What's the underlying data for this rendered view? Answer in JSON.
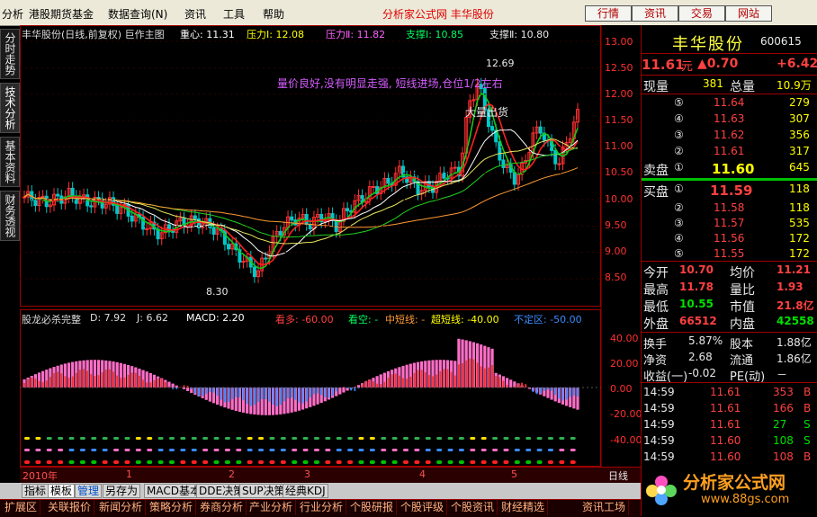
{
  "menu": [
    "分析",
    "港股期货基金",
    "数据查询(N)",
    "资讯",
    "工具",
    "帮助"
  ],
  "top_link": "分析家公式网 丰华股份",
  "top_buttons": [
    "行情",
    "资讯",
    "交易",
    "网站"
  ],
  "left_tabs": [
    "分时走势",
    "技术分析",
    "基本资料",
    "财务透视"
  ],
  "main_header": {
    "title": "丰华股份(日线,前复权) 巨作主图",
    "zhongxin": "重心: 11.31",
    "yali1": "压力Ⅰ: 12.08",
    "yali2": "压力Ⅱ: 11.82",
    "zhicheng1": "支撑Ⅰ: 10.85",
    "zhicheng2": "支撑Ⅱ: 10.80"
  },
  "annotations": {
    "comment": "量价良好,没有明显走强, 短线进场,仓位1/2左右",
    "ship": "大量出货",
    "high_label": "12.69",
    "low_label": "8.30"
  },
  "price_axis": [
    "13.00",
    "12.50",
    "12.00",
    "11.50",
    "11.00",
    "10.50",
    "10.00",
    "9.50",
    "9.00",
    "8.50"
  ],
  "indicator_header": {
    "title": "股龙必杀完整",
    "d": "D: 7.92",
    "j": "J: 6.62",
    "macd": "MACD: 2.20",
    "kanduo": "看多: -60.00",
    "kankong": "看空: -",
    "zhongduan": "中短线: -",
    "chaoduan": "超短线: -40.00",
    "buding": "不定区: -50.00"
  },
  "indicator_axis": [
    "40.00",
    "20.00",
    "0.00",
    "-20.00",
    "-40.00"
  ],
  "time_axis": {
    "year": "2010年",
    "months": [
      "1",
      "2",
      "3",
      "4",
      "5"
    ],
    "period": "日线"
  },
  "bottom_tabs": [
    "指标",
    "模板",
    "管理",
    "另存为",
    "MACD基本",
    "DDE决策",
    "SUP决策",
    "经典KDJ"
  ],
  "bottom_nav": [
    "扩展区",
    "关联报价",
    "新闻分析",
    "策略分析",
    "券商分析",
    "产业分析",
    "行业分析",
    "个股研报",
    "个股评级",
    "个股资讯",
    "财经精选",
    "资讯工场"
  ],
  "quote": {
    "name": "丰华股份",
    "code": "600615",
    "price": "11.61",
    "price_unit": "元",
    "change": "▲0.70",
    "pct": "+6.42",
    "xianliang_label": "现量",
    "xianliang": "381",
    "zongliang_label": "总量",
    "zongliang": "10.9万",
    "sell": [
      {
        "lv": "⑤",
        "price": "11.64",
        "vol": "279"
      },
      {
        "lv": "④",
        "price": "11.63",
        "vol": "307"
      },
      {
        "lv": "③",
        "price": "11.62",
        "vol": "356"
      },
      {
        "lv": "②",
        "price": "11.61",
        "vol": "317"
      }
    ],
    "sell1": {
      "label": "卖盘",
      "lv": "①",
      "price": "11.60",
      "vol": "645"
    },
    "buy1": {
      "label": "买盘",
      "lv": "①",
      "price": "11.59",
      "vol": "118"
    },
    "buy": [
      {
        "lv": "②",
        "price": "11.58",
        "vol": "118"
      },
      {
        "lv": "③",
        "price": "11.57",
        "vol": "535"
      },
      {
        "lv": "④",
        "price": "11.56",
        "vol": "172"
      },
      {
        "lv": "⑤",
        "price": "11.55",
        "vol": "172"
      }
    ],
    "stats": [
      {
        "l1": "今开",
        "v1": "10.70",
        "l2": "均价",
        "v2": "11.21"
      },
      {
        "l1": "最高",
        "v1": "11.78",
        "l2": "量比",
        "v2": "1.93"
      },
      {
        "l1": "最低",
        "v1": "10.55",
        "l2": "市值",
        "v2": "21.8亿"
      },
      {
        "l1": "外盘",
        "v1": "66512",
        "l2": "内盘",
        "v2": "42558"
      }
    ],
    "stats2": [
      {
        "l1": "换手",
        "v1": "5.87%",
        "l2": "股本",
        "v2": "1.88亿"
      },
      {
        "l1": "净资",
        "v1": "2.68",
        "l2": "流通",
        "v2": "1.86亿"
      },
      {
        "l1": "收益(一)",
        "v1": "-0.02",
        "l2": "PE(动)",
        "v2": "－"
      }
    ],
    "ticks": [
      {
        "t": "14:59",
        "p": "11.61",
        "v": "353",
        "s": "B"
      },
      {
        "t": "14:59",
        "p": "11.61",
        "v": "166",
        "s": "B"
      },
      {
        "t": "14:59",
        "p": "11.61",
        "v": "27",
        "s": "S"
      },
      {
        "t": "14:59",
        "p": "11.60",
        "v": "108",
        "s": "S"
      },
      {
        "t": "14:59",
        "p": "11.60",
        "v": "108",
        "s": "B"
      }
    ],
    "logo_text": "分析家公式网",
    "logo_url": "www.88gs.com"
  },
  "colors": {
    "up": "#ff3030",
    "down": "#00c8c8",
    "ma_red": "#ff2020",
    "ma_green": "#18c818",
    "ma_yellow": "#e8e860",
    "pink": "#ff6ec7",
    "orange": "#ffa64d",
    "macd_blue": "#3a8bff"
  }
}
